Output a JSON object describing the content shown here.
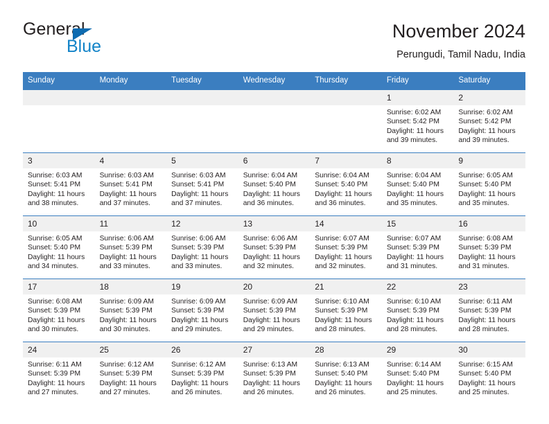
{
  "brand": {
    "name_part1": "General",
    "name_part2": "Blue",
    "flag_icon": "triangle-flag-icon"
  },
  "header": {
    "title": "November 2024",
    "subtitle": "Perungudi, Tamil Nadu, India"
  },
  "colors": {
    "header_blue": "#3b7ec0",
    "brand_blue": "#1283c8",
    "flag_blue": "#0d6bb0",
    "daynum_band": "#f0f0f0",
    "text": "#231f20"
  },
  "weekdays": [
    "Sunday",
    "Monday",
    "Tuesday",
    "Wednesday",
    "Thursday",
    "Friday",
    "Saturday"
  ],
  "weeks": [
    [
      {
        "day": "",
        "empty": true
      },
      {
        "day": "",
        "empty": true
      },
      {
        "day": "",
        "empty": true
      },
      {
        "day": "",
        "empty": true
      },
      {
        "day": "",
        "empty": true
      },
      {
        "day": "1",
        "sunrise": "Sunrise: 6:02 AM",
        "sunset": "Sunset: 5:42 PM",
        "daylight": "Daylight: 11 hours and 39 minutes."
      },
      {
        "day": "2",
        "sunrise": "Sunrise: 6:02 AM",
        "sunset": "Sunset: 5:42 PM",
        "daylight": "Daylight: 11 hours and 39 minutes."
      }
    ],
    [
      {
        "day": "3",
        "sunrise": "Sunrise: 6:03 AM",
        "sunset": "Sunset: 5:41 PM",
        "daylight": "Daylight: 11 hours and 38 minutes."
      },
      {
        "day": "4",
        "sunrise": "Sunrise: 6:03 AM",
        "sunset": "Sunset: 5:41 PM",
        "daylight": "Daylight: 11 hours and 37 minutes."
      },
      {
        "day": "5",
        "sunrise": "Sunrise: 6:03 AM",
        "sunset": "Sunset: 5:41 PM",
        "daylight": "Daylight: 11 hours and 37 minutes."
      },
      {
        "day": "6",
        "sunrise": "Sunrise: 6:04 AM",
        "sunset": "Sunset: 5:40 PM",
        "daylight": "Daylight: 11 hours and 36 minutes."
      },
      {
        "day": "7",
        "sunrise": "Sunrise: 6:04 AM",
        "sunset": "Sunset: 5:40 PM",
        "daylight": "Daylight: 11 hours and 36 minutes."
      },
      {
        "day": "8",
        "sunrise": "Sunrise: 6:04 AM",
        "sunset": "Sunset: 5:40 PM",
        "daylight": "Daylight: 11 hours and 35 minutes."
      },
      {
        "day": "9",
        "sunrise": "Sunrise: 6:05 AM",
        "sunset": "Sunset: 5:40 PM",
        "daylight": "Daylight: 11 hours and 35 minutes."
      }
    ],
    [
      {
        "day": "10",
        "sunrise": "Sunrise: 6:05 AM",
        "sunset": "Sunset: 5:40 PM",
        "daylight": "Daylight: 11 hours and 34 minutes."
      },
      {
        "day": "11",
        "sunrise": "Sunrise: 6:06 AM",
        "sunset": "Sunset: 5:39 PM",
        "daylight": "Daylight: 11 hours and 33 minutes."
      },
      {
        "day": "12",
        "sunrise": "Sunrise: 6:06 AM",
        "sunset": "Sunset: 5:39 PM",
        "daylight": "Daylight: 11 hours and 33 minutes."
      },
      {
        "day": "13",
        "sunrise": "Sunrise: 6:06 AM",
        "sunset": "Sunset: 5:39 PM",
        "daylight": "Daylight: 11 hours and 32 minutes."
      },
      {
        "day": "14",
        "sunrise": "Sunrise: 6:07 AM",
        "sunset": "Sunset: 5:39 PM",
        "daylight": "Daylight: 11 hours and 32 minutes."
      },
      {
        "day": "15",
        "sunrise": "Sunrise: 6:07 AM",
        "sunset": "Sunset: 5:39 PM",
        "daylight": "Daylight: 11 hours and 31 minutes."
      },
      {
        "day": "16",
        "sunrise": "Sunrise: 6:08 AM",
        "sunset": "Sunset: 5:39 PM",
        "daylight": "Daylight: 11 hours and 31 minutes."
      }
    ],
    [
      {
        "day": "17",
        "sunrise": "Sunrise: 6:08 AM",
        "sunset": "Sunset: 5:39 PM",
        "daylight": "Daylight: 11 hours and 30 minutes."
      },
      {
        "day": "18",
        "sunrise": "Sunrise: 6:09 AM",
        "sunset": "Sunset: 5:39 PM",
        "daylight": "Daylight: 11 hours and 30 minutes."
      },
      {
        "day": "19",
        "sunrise": "Sunrise: 6:09 AM",
        "sunset": "Sunset: 5:39 PM",
        "daylight": "Daylight: 11 hours and 29 minutes."
      },
      {
        "day": "20",
        "sunrise": "Sunrise: 6:09 AM",
        "sunset": "Sunset: 5:39 PM",
        "daylight": "Daylight: 11 hours and 29 minutes."
      },
      {
        "day": "21",
        "sunrise": "Sunrise: 6:10 AM",
        "sunset": "Sunset: 5:39 PM",
        "daylight": "Daylight: 11 hours and 28 minutes."
      },
      {
        "day": "22",
        "sunrise": "Sunrise: 6:10 AM",
        "sunset": "Sunset: 5:39 PM",
        "daylight": "Daylight: 11 hours and 28 minutes."
      },
      {
        "day": "23",
        "sunrise": "Sunrise: 6:11 AM",
        "sunset": "Sunset: 5:39 PM",
        "daylight": "Daylight: 11 hours and 28 minutes."
      }
    ],
    [
      {
        "day": "24",
        "sunrise": "Sunrise: 6:11 AM",
        "sunset": "Sunset: 5:39 PM",
        "daylight": "Daylight: 11 hours and 27 minutes."
      },
      {
        "day": "25",
        "sunrise": "Sunrise: 6:12 AM",
        "sunset": "Sunset: 5:39 PM",
        "daylight": "Daylight: 11 hours and 27 minutes."
      },
      {
        "day": "26",
        "sunrise": "Sunrise: 6:12 AM",
        "sunset": "Sunset: 5:39 PM",
        "daylight": "Daylight: 11 hours and 26 minutes."
      },
      {
        "day": "27",
        "sunrise": "Sunrise: 6:13 AM",
        "sunset": "Sunset: 5:39 PM",
        "daylight": "Daylight: 11 hours and 26 minutes."
      },
      {
        "day": "28",
        "sunrise": "Sunrise: 6:13 AM",
        "sunset": "Sunset: 5:40 PM",
        "daylight": "Daylight: 11 hours and 26 minutes."
      },
      {
        "day": "29",
        "sunrise": "Sunrise: 6:14 AM",
        "sunset": "Sunset: 5:40 PM",
        "daylight": "Daylight: 11 hours and 25 minutes."
      },
      {
        "day": "30",
        "sunrise": "Sunrise: 6:15 AM",
        "sunset": "Sunset: 5:40 PM",
        "daylight": "Daylight: 11 hours and 25 minutes."
      }
    ]
  ]
}
